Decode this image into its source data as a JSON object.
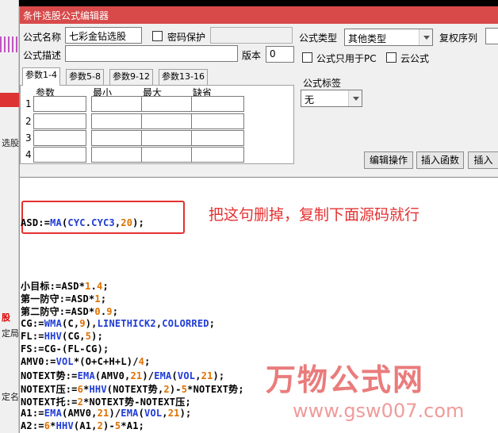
{
  "background": {
    "left_labels": [
      "选股",
      "股ň",
      "定局",
      "定名"
    ],
    "left_label_visible": [
      "选股",
      "股",
      "定局",
      "定名"
    ]
  },
  "dialog": {
    "title": "条件选股公式编辑器"
  },
  "form": {
    "formula_name_label": "公式名称",
    "formula_name_value": "七彩金钻选股",
    "password_label": "密码保护",
    "formula_type_label": "公式类型",
    "formula_type_value": "其他类型",
    "restore_order_label": "复权序列",
    "description_label": "公式描述",
    "version_label": "版本",
    "version_value": "0",
    "pc_only_label": "公式只用于PC",
    "cloud_label": "云公式",
    "tag_label": "公式标签",
    "tag_value": "无"
  },
  "tabs": [
    {
      "label": "参数1-4",
      "active": true
    },
    {
      "label": "参数5-8",
      "active": false
    },
    {
      "label": "参数9-12",
      "active": false
    },
    {
      "label": "参数13-16",
      "active": false
    }
  ],
  "param_table": {
    "headers": [
      "参数",
      "最小",
      "最大",
      "缺省"
    ],
    "rows": [
      "1",
      "2",
      "3",
      "4"
    ]
  },
  "buttons": {
    "edit_ops": "编辑操作",
    "insert_func": "插入函数",
    "insert_more": "插入"
  },
  "editor": {
    "annotation": "把这句删掉，复制下面源码就行",
    "line_asd": {
      "a": "ASD:=",
      "b": "MA",
      "c": "(",
      "d": "CYC",
      "e": ".",
      "f": "CYC3",
      "g": ",",
      "h": "20",
      "i": ");"
    },
    "lines": [
      "小目标:=ASD*1.4;",
      "第一防守:=ASD*1;",
      "第二防守:=ASD*0.9;",
      "CG:=WMA(C,9),LINETHICK2,COLORRED;",
      "FL:=HHV(CG,5);",
      "FS:=CG-(FL-CG);",
      "AMV0:=VOL*(O+C+H+L)/4;",
      "NOTEXT势:=EMA(AMV0,21)/EMA(VOL,21);",
      "NOTEXT压:=6*HHV(NOTEXT势,2)-5*NOTEXT势;",
      "NOTEXT托:=2*NOTEXT势-NOTEXT压;",
      "A1:=EMA(AMV0,21)/EMA(VOL,21);",
      "A2:=6*HHV(A1,2)-5*A1;"
    ]
  },
  "watermark": {
    "title": "万物公式网",
    "url": "www.gsw007.com"
  },
  "colors": {
    "titlebar": "#d84a4a",
    "annotation": "#e53030",
    "keyword": "#1f3bd6",
    "number": "#e07000"
  }
}
